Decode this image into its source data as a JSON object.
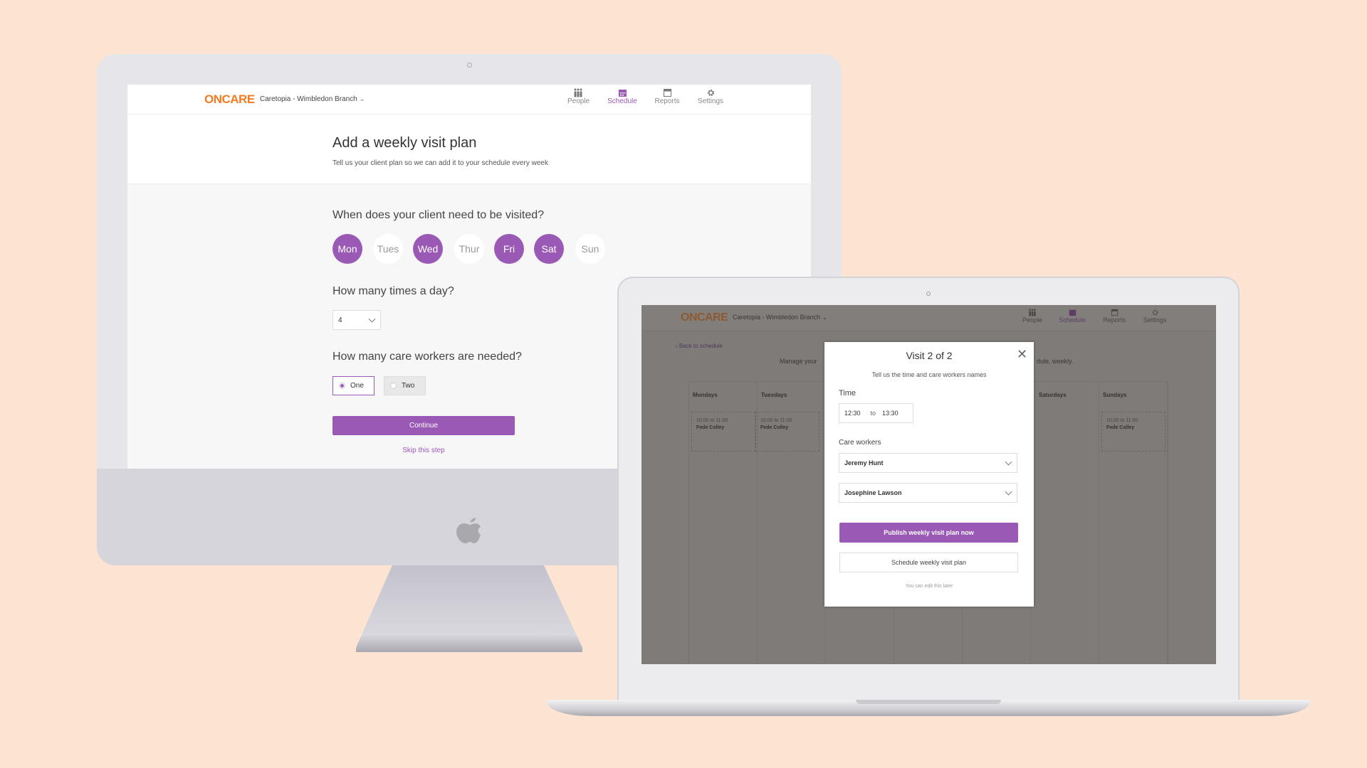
{
  "colors": {
    "accent": "#9b59b6",
    "brand": "#f47b20",
    "background": "#fde3d1"
  },
  "app": {
    "logo": "ONCARE",
    "branch": "Caretopia - Wimbledon Branch",
    "nav": [
      {
        "label": "People",
        "icon": "people-icon"
      },
      {
        "label": "Schedule",
        "icon": "calendar-icon",
        "active": true
      },
      {
        "label": "Reports",
        "icon": "reports-icon"
      },
      {
        "label": "Settings",
        "icon": "gear-icon"
      }
    ]
  },
  "desktop": {
    "title": "Add a weekly visit plan",
    "subtitle": "Tell us your client plan so we can add it to your schedule every week",
    "q_days": "When does your client need to be visited?",
    "days": [
      {
        "label": "Mon",
        "selected": true
      },
      {
        "label": "Tues",
        "selected": false
      },
      {
        "label": "Wed",
        "selected": true
      },
      {
        "label": "Thur",
        "selected": false
      },
      {
        "label": "Fri",
        "selected": true
      },
      {
        "label": "Sat",
        "selected": true
      },
      {
        "label": "Sun",
        "selected": false
      }
    ],
    "q_times": "How many times a day?",
    "times_value": "4",
    "q_workers": "How many care workers are needed?",
    "workers_options": [
      {
        "label": "One",
        "selected": true
      },
      {
        "label": "Two",
        "selected": false
      }
    ],
    "continue": "Continue",
    "skip": "Skip this step"
  },
  "laptop": {
    "back": "Back to schedule",
    "intro_left": "Manage your",
    "intro_right": "dule, weekly.",
    "columns": [
      "Mondays",
      "Tuesdays",
      "Saturdays",
      "Sundays"
    ],
    "card_time": "10:00 to 11:00",
    "card_name": "Fede Colley",
    "modal": {
      "title": "Visit 2 of 2",
      "subtitle": "Tell us the time and care workers names",
      "time_label": "Time",
      "time_from": "12:30",
      "time_to_word": "to",
      "time_to": "13:30",
      "workers_label": "Care workers",
      "workers": [
        "Jeremy Hunt",
        "Josephine Lawson"
      ],
      "publish": "Publish weekly visit plan now",
      "schedule": "Schedule weekly visit plan",
      "note": "You can edit this later"
    }
  }
}
